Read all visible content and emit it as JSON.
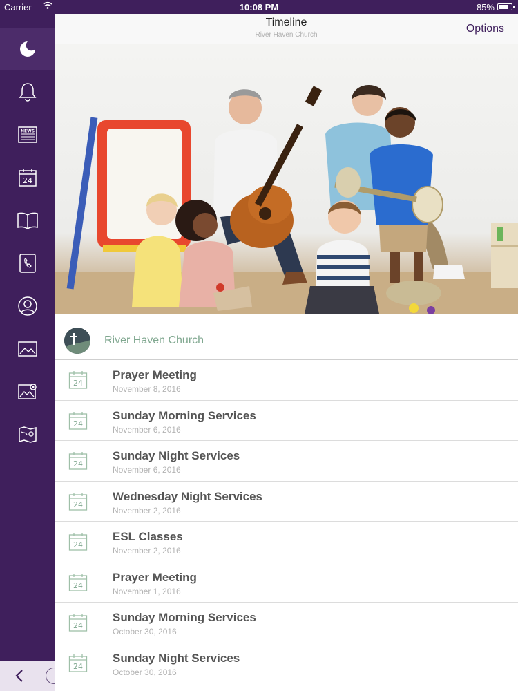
{
  "status": {
    "carrier": "Carrier",
    "time": "10:08 PM",
    "battery": "85%"
  },
  "sidebar": {
    "items": [
      {
        "icon": "church-logo-icon",
        "active": true
      },
      {
        "icon": "bell-icon"
      },
      {
        "icon": "news-icon",
        "label": "NEWS"
      },
      {
        "icon": "calendar-icon",
        "label": "24"
      },
      {
        "icon": "book-icon"
      },
      {
        "icon": "contacts-icon"
      },
      {
        "icon": "profile-icon"
      },
      {
        "icon": "gallery-icon"
      },
      {
        "icon": "media-icon"
      },
      {
        "icon": "map-icon"
      }
    ],
    "back_icon": "chevron-left-icon"
  },
  "navbar": {
    "title": "Timeline",
    "subtitle": "River Haven Church",
    "options_label": "Options"
  },
  "church": {
    "name": "River Haven Church"
  },
  "events": [
    {
      "title": "Prayer Meeting",
      "date": "November 8, 2016",
      "day": "24"
    },
    {
      "title": "Sunday Morning Services",
      "date": "November 6, 2016",
      "day": "24"
    },
    {
      "title": "Sunday Night Services",
      "date": "November 6, 2016",
      "day": "24"
    },
    {
      "title": "Wednesday Night Services",
      "date": "November 2, 2016",
      "day": "24"
    },
    {
      "title": "ESL Classes",
      "date": "November 2, 2016",
      "day": "24"
    },
    {
      "title": "Prayer Meeting",
      "date": "November 1, 2016",
      "day": "24"
    },
    {
      "title": "Sunday Morning Services",
      "date": "October 30, 2016",
      "day": "24"
    },
    {
      "title": "Sunday Night Services",
      "date": "October 30, 2016",
      "day": "24"
    }
  ],
  "colors": {
    "sidebar": "#3f1f5c",
    "accent": "#7fa78f",
    "options": "#3f1f5c"
  }
}
